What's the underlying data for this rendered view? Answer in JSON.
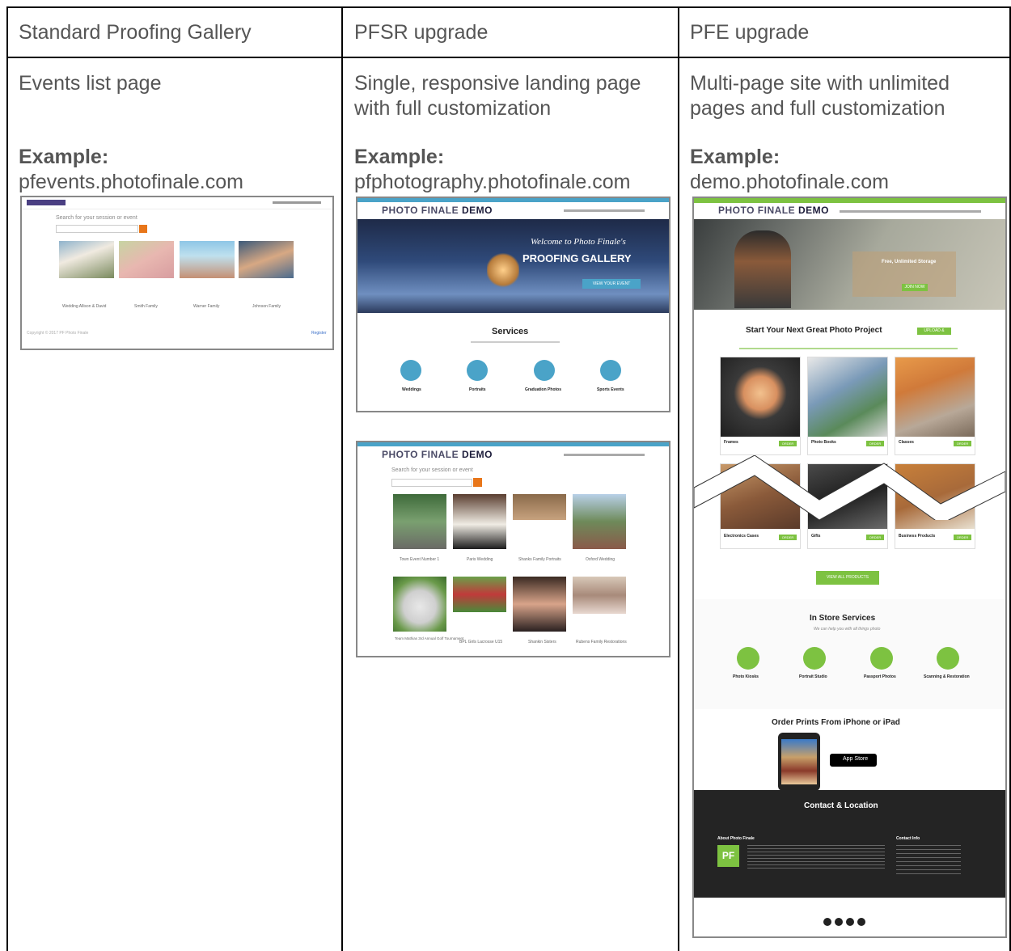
{
  "columns": [
    {
      "header": "Standard Proofing Gallery",
      "description": "Events list page",
      "example_label": "Example:",
      "example_url": "pfevents.photofinale.com"
    },
    {
      "header": "PFSR upgrade",
      "description": "Single, responsive landing page with full customization",
      "example_label": "Example:",
      "example_url": "pfphotography.photofinale.com"
    },
    {
      "header": "PFE upgrade",
      "description": "Multi-page site with unlimited pages and full customization",
      "example_label": "Example:",
      "example_url": "demo.photofinale.com"
    }
  ],
  "shot1": {
    "search_label": "Search for your session or event",
    "events": [
      "Wedding Allison & David",
      "Smith Family",
      "Warner Family",
      "Johnson Family"
    ],
    "footer_left": "Copyright © 2017 PF Photo Finale",
    "footer_right": "Register"
  },
  "shot2": {
    "logo_a": "PHOTO FINALE",
    "logo_b": "DEMO",
    "hero_line1": "Welcome to Photo Finale's",
    "hero_line2": "PROOFING GALLERY",
    "hero_button": "VIEW YOUR EVENT",
    "services_title": "Services",
    "services": [
      "Weddings",
      "Portraits",
      "Graduation Photos",
      "Sports Events"
    ]
  },
  "shot3": {
    "logo_a": "PHOTO FINALE",
    "logo_b": "DEMO",
    "search_label": "Search for your session or event",
    "events_row1": [
      "Town Event Number 1",
      "Paris Wedding",
      "Shanks Family Portraits",
      "Oxford Wedding"
    ],
    "events_row2": [
      "Team Mathias 3rd Annual Golf Tournament",
      "BPL Girls Lacrosse U15",
      "Shankin Sisters",
      "Rubens Family Restorations"
    ]
  },
  "shot4": {
    "logo_a": "PHOTO FINALE",
    "logo_b": "DEMO",
    "hero_text": "Free, Unlimited Storage",
    "hero_button": "JOIN NOW",
    "project_title": "Start Your Next Great Photo Project",
    "project_button": "UPLOAD & ORDER",
    "products_row1": [
      "Frames",
      "Photo Books",
      "Classes"
    ],
    "products_row2": [
      "Electronics Cases",
      "Gifts",
      "Business Products"
    ],
    "order_label": "ORDER",
    "view_all": "VIEW ALL PRODUCTS",
    "instore_title": "In Store Services",
    "instore_sub": "We can help you with all things photo",
    "instore_services": [
      "Photo Kiosks",
      "Portrait Studio",
      "Passport Photos",
      "Scanning & Restoration"
    ],
    "order_prints_title": "Order Prints From iPhone or iPad",
    "app_store": "App Store",
    "contact_title": "Contact & Location",
    "about_label": "About Photo Finale",
    "contact_info_label": "Contact Info",
    "pf_badge": "PF"
  },
  "colors": {
    "border": "#000000",
    "text": "#555555",
    "accent_green": "#7dc241",
    "accent_orange": "#e8761a",
    "accent_teal": "#4aa3c8"
  }
}
